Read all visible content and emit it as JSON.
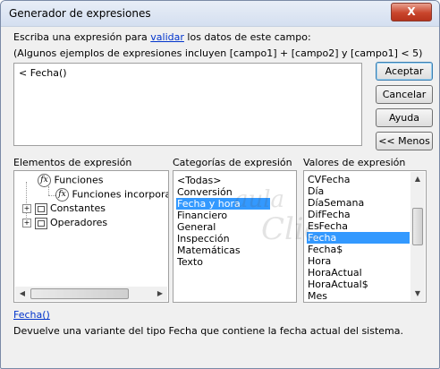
{
  "window": {
    "title": "Generador de expresiones",
    "close_glyph": "X"
  },
  "instructions": {
    "line1_before": "Escriba una expresión para ",
    "line1_link": "validar",
    "line1_after": " los datos de este campo:",
    "line2": "(Algunos ejemplos de expresiones incluyen [campo1] + [campo2] y [campo1] < 5)"
  },
  "expression": {
    "value": "< Fecha()"
  },
  "buttons": {
    "accept": "Aceptar",
    "cancel": "Cancelar",
    "help": "Ayuda",
    "less": "<< Menos"
  },
  "elements": {
    "label": "Elementos de expresión",
    "items": [
      {
        "label": "Funciones",
        "icon": "function-icon",
        "expander": ""
      },
      {
        "label": "Funciones incorporadas",
        "icon": "function-icon"
      },
      {
        "label": "Constantes",
        "icon": "folder-icon",
        "expander": "+"
      },
      {
        "label": "Operadores",
        "icon": "folder-icon",
        "expander": "+"
      }
    ]
  },
  "categories": {
    "label": "Categorías de expresión",
    "items": [
      "<Todas>",
      "Conversión",
      "Fecha y hora",
      "Financiero",
      "General",
      "Inspección",
      "Matemáticas",
      "Texto"
    ],
    "selected": "Fecha y hora"
  },
  "values": {
    "label": "Valores de expresión",
    "items": [
      "CVFecha",
      "Día",
      "DíaSemana",
      "DifFecha",
      "EsFecha",
      "Fecha",
      "Fecha$",
      "Hora",
      "HoraActual",
      "HoraActual$",
      "Mes"
    ],
    "selected": "Fecha"
  },
  "footer": {
    "function_link": "Fecha()",
    "description": "Devuelve una variante del tipo Fecha que contiene la fecha actual del sistema."
  },
  "watermark_text": "aula Clic"
}
